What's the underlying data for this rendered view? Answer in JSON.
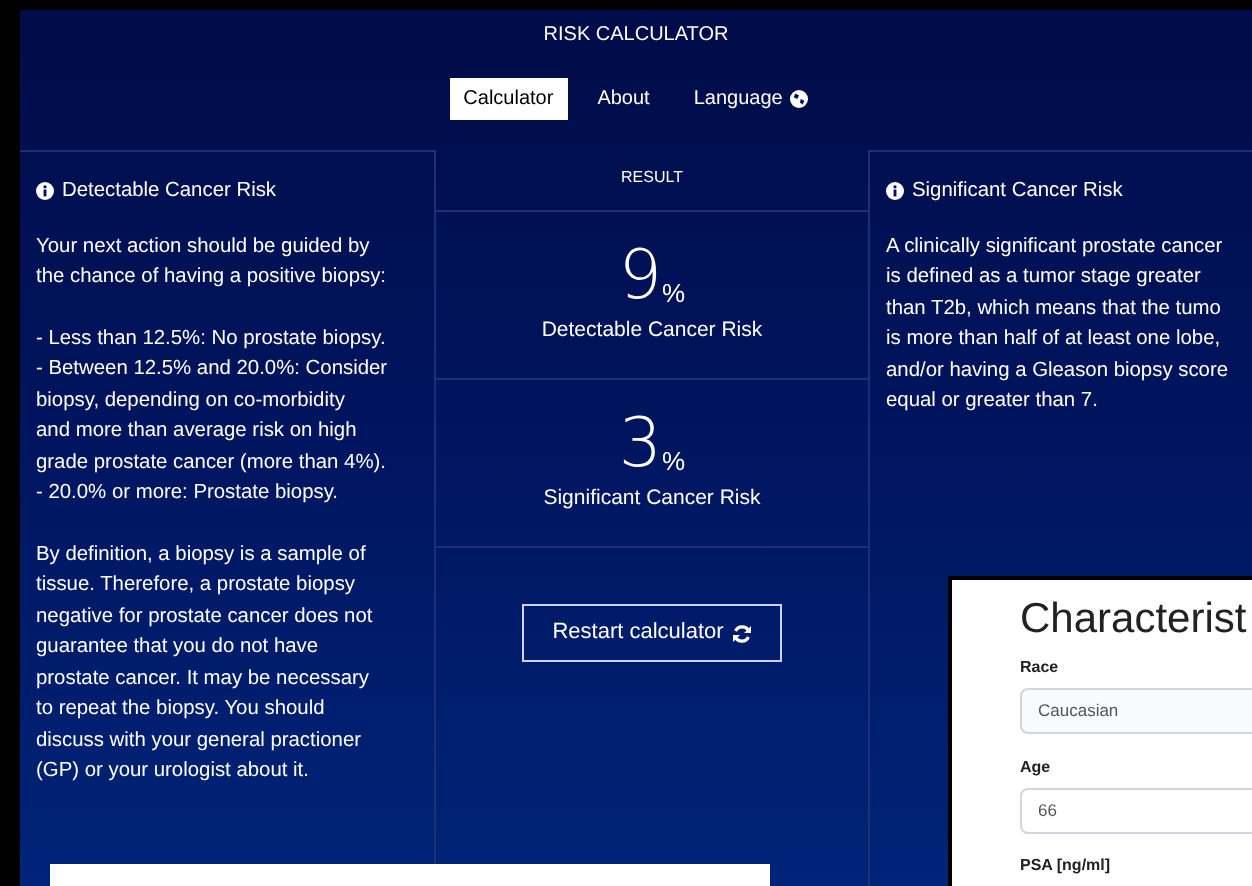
{
  "header": {
    "title": "RISK CALCULATOR",
    "tabs": [
      {
        "label": "Calculator",
        "selected": true,
        "kind": "plain"
      },
      {
        "label": "About",
        "selected": false,
        "kind": "plain"
      },
      {
        "label": "Language",
        "selected": false,
        "kind": "picker"
      }
    ]
  },
  "left_panel": {
    "title": "Detectable Cancer Risk",
    "paragraphs": [
      [
        "Your next action should be guided by",
        "the chance of having a positive biopsy:"
      ],
      [
        "- Less than 12.5%: No prostate biopsy.",
        "- Between 12.5% and 20.0%: Consider",
        "biopsy, depending on co-morbidity",
        "and more than average risk on high",
        "grade prostate cancer (more than 4%).",
        "- 20.0% or more: Prostate biopsy."
      ],
      [
        "By definition, a biopsy is a sample of",
        "tissue. Therefore, a prostate biopsy",
        "negative for prostate cancer does not",
        "guarantee that you do not have",
        "prostate cancer. It may be necessary",
        "to repeat the biopsy. You should",
        "discuss with your general practioner",
        "(GP) or your urologist about it."
      ]
    ]
  },
  "result": {
    "heading": "RESULT",
    "results": [
      {
        "value": "9",
        "unit": "%",
        "label": "Detectable Cancer Risk"
      },
      {
        "value": "3",
        "unit": "%",
        "label": "Significant Cancer Risk"
      }
    ],
    "restart_button": "Restart calculator"
  },
  "right_panel": {
    "title": "Significant Cancer Risk",
    "paragraphs": [
      [
        "A clinically significant prostate cancer",
        "is defined as a tumor stage greater",
        "than T2b, which means that the tumo",
        "is more than half of at least one lobe,",
        "and/or having a Gleason biopsy score",
        "equal or greater than 7."
      ]
    ]
  },
  "characteristics_card": {
    "title": "Characterist",
    "fields": [
      {
        "label": "Race",
        "kind": "select",
        "value": "Caucasian"
      },
      {
        "label": "Age",
        "kind": "input",
        "value": "66"
      }
    ],
    "next_label": "PSA [ng/ml]"
  }
}
